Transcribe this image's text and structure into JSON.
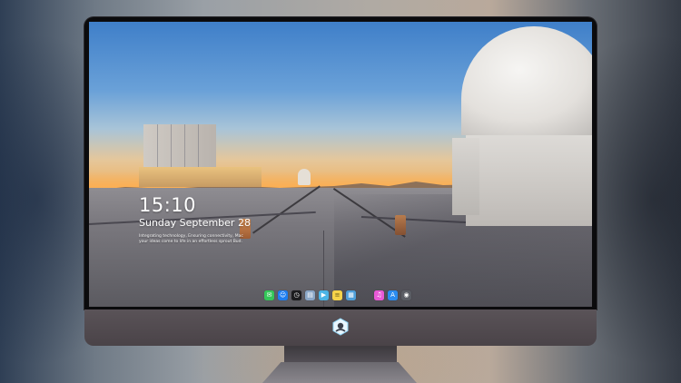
{
  "lockscreen": {
    "time": "15:10",
    "date": "Sunday September 28",
    "tagline": "Integrating technology, Ensuring connectivity, Mac your ideas come to life in an effortless sprout Bud."
  },
  "dock": {
    "apps": [
      {
        "name": "messages-icon",
        "color": "#34c759",
        "glyph": "✉"
      },
      {
        "name": "finder-icon",
        "color": "#1e7ef0",
        "glyph": "☺"
      },
      {
        "name": "clock-icon",
        "color": "#1c1c1e",
        "glyph": "◷"
      },
      {
        "name": "preview-icon",
        "color": "#8aa7c7",
        "glyph": "▤"
      },
      {
        "name": "video-editor-icon",
        "color": "#4bb4e6",
        "glyph": "▶"
      },
      {
        "name": "notes-icon",
        "color": "#f6d34a",
        "glyph": "≡"
      },
      {
        "name": "photos-icon",
        "color": "#4f9fd9",
        "glyph": "▦"
      },
      {
        "name": "itunes-icon",
        "color": "#e85ad6",
        "glyph": "♫"
      },
      {
        "name": "app-store-icon",
        "color": "#2b8cf0",
        "glyph": "A"
      },
      {
        "name": "camera-icon",
        "color": "#5a5d64",
        "glyph": "◉"
      }
    ]
  },
  "colors": {
    "bezel": "#0b0b0d",
    "chin": "#514a4f",
    "stand": "#6c6a70"
  }
}
